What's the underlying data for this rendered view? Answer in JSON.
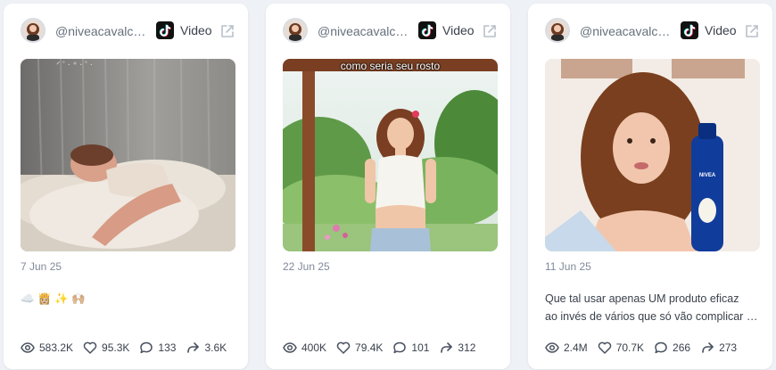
{
  "colors": {
    "card_bg": "#ffffff",
    "page_bg": "#eef1f5",
    "muted_text": "#80899a",
    "body_text": "#3a414c"
  },
  "cards": [
    {
      "handle": "@niveacavalcante",
      "platform_icon": "tiktok-icon",
      "type_label": "Video",
      "date": "7 Jun 25",
      "overlay_text": "",
      "caption": [
        "☁️ 👸🏼 ✨ 🙌🏼"
      ],
      "stats": {
        "views": "583.2K",
        "likes": "95.3K",
        "comments": "133",
        "shares": "3.6K"
      }
    },
    {
      "handle": "@niveacavalcante",
      "platform_icon": "tiktok-icon",
      "type_label": "Video",
      "date": "22 Jun 25",
      "overlay_text": "como seria seu rosto",
      "caption": [],
      "stats": {
        "views": "400K",
        "likes": "79.4K",
        "comments": "101",
        "shares": "312"
      }
    },
    {
      "handle": "@niveacavalcante",
      "platform_icon": "tiktok-icon",
      "type_label": "Video",
      "date": "11 Jun 25",
      "overlay_text": "",
      "caption": [
        "Que tal usar apenas UM produto eficaz",
        "ao invés de vários que só vão complicar sua rotina?"
      ],
      "stats": {
        "views": "2.4M",
        "likes": "70.7K",
        "comments": "266",
        "shares": "273"
      }
    }
  ]
}
